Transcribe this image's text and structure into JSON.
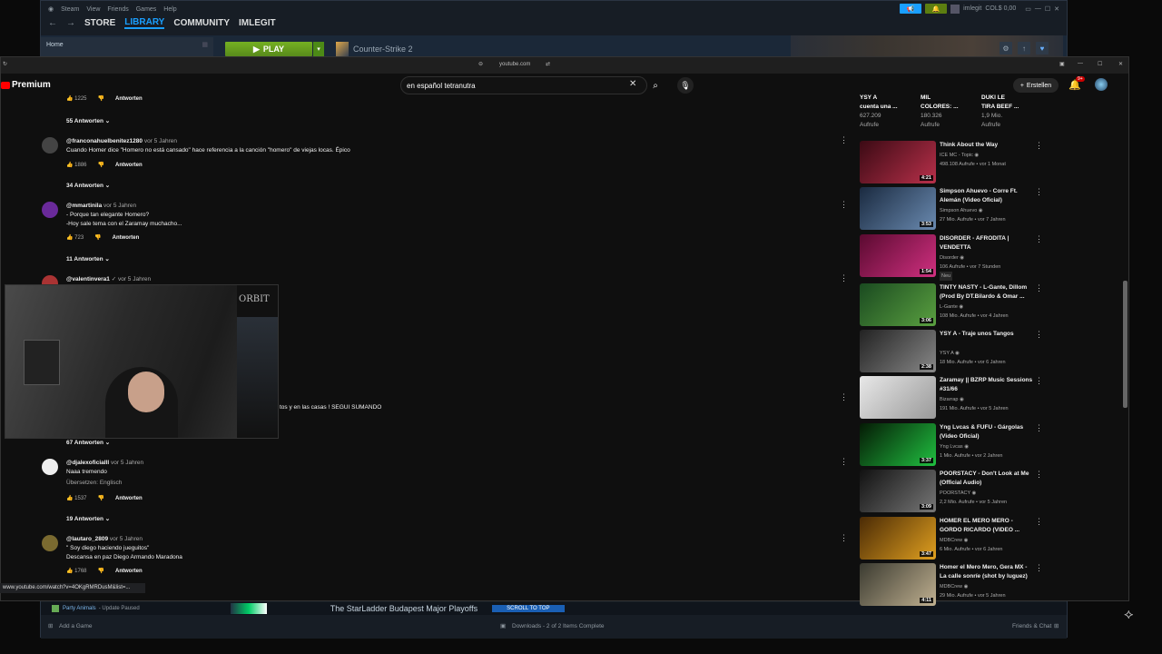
{
  "steam": {
    "menu": [
      "Steam",
      "View",
      "Friends",
      "Games",
      "Help"
    ],
    "nav": [
      "STORE",
      "LIBRARY",
      "COMMUNITY",
      "IMLEGIT"
    ],
    "nav_active": "LIBRARY",
    "user": "imlegit",
    "wallet": "COL$ 0,00",
    "home": "Home",
    "play": "PLAY",
    "game": "Counter-Strike 2",
    "update_item": "Party Animals",
    "update_status": "- Update Paused",
    "news_title": "The StarLadder Budapest Major Playoffs",
    "scroll_top": "SCROLL TO TOP",
    "add_game": "Add a Game",
    "downloads": "Downloads - 2 of 2 Items Complete",
    "friends_chat": "Friends & Chat"
  },
  "browser": {
    "url": "youtube.com",
    "search_value": "en español tetranutra",
    "logo": "Premium",
    "create": "Erstellen",
    "notif_count": "9+",
    "link_hint": "www.youtube.com/watch?v=4OKgRMRDusM&list=..."
  },
  "comments": [
    {
      "type": "acts",
      "likes": "1225",
      "reply": "Antworten"
    },
    {
      "type": "replies",
      "label": "55 Antworten"
    },
    {
      "user": "@franconahuelbenitez1280",
      "when": "vor 5 Jahren",
      "text": "Cuando Homer dice \"Homero no está cansado\" hace referencia a la canción \"homero\" de viejas locas. Épico",
      "likes": "1886",
      "reply": "Antworten",
      "replies": "34 Antworten"
    },
    {
      "user": "@mmartinila",
      "when": "vor 5 Jahren",
      "text": "- Porque tan elegante Homero?",
      "text2": "-Hoy sale tema con el Zaramay muchacho...",
      "likes": "723",
      "reply": "Antworten",
      "replies": "11 Antworten"
    },
    {
      "user": "@valentinvera1",
      "when": "✓ vor 5 Jahren"
    },
    {
      "type": "partial",
      "text": "tos y en las casas ! SEGUI SUMANDO",
      "replies": "67 Antworten"
    },
    {
      "user": "@djalexoficialll",
      "when": "vor 5 Jahren",
      "text": "Naaa tremendo",
      "text2": "Übersetzen: Englisch",
      "likes": "1537",
      "reply": "Antworten",
      "replies": "19 Antworten"
    },
    {
      "user": "@lautaro_2809",
      "when": "vor 5 Jahren",
      "text": "\" Soy diego haciendo jueguitos\"",
      "text2": "Descansa en paz Diego Armando Maradona",
      "likes": "1768",
      "reply": "Antworten"
    }
  ],
  "shorts_top": [
    {
      "title": "YSY A",
      "title2": "cuenta una ...",
      "views": "627.209",
      "unit": "Aufrufe"
    },
    {
      "title": "MIL",
      "title2": "COLORES: ...",
      "views": "180.326",
      "unit": "Aufrufe"
    },
    {
      "title": "DUKI LE",
      "title2": "TIRA BEEF ...",
      "views": "1,9 Mio.",
      "unit": "Aufrufe"
    }
  ],
  "sidebar": [
    {
      "title": "Think About the Way",
      "channel": "ICE MC - Topic",
      "meta": "498.108 Aufrufe • vor 1 Monat",
      "dur": "4:21",
      "c1": "#3b0a14",
      "c2": "#b8304a"
    },
    {
      "title": "Simpson Ahuevo - Corre Ft. Alemán (Video Oficial)",
      "channel": "Simpson Ahuevo",
      "meta": "27 Mio. Aufrufe • vor 7 Jahren",
      "dur": "3:53",
      "c1": "#1a2a40",
      "c2": "#6a8ab0"
    },
    {
      "title": "DISORDER - AFRODITA | VENDETTA",
      "channel": "Disorder",
      "meta": "106 Aufrufe • vor 7 Stunden",
      "extra": "Neu",
      "dur": "1:54",
      "c1": "#5a0a30",
      "c2": "#d03080"
    },
    {
      "title": "TINTY NASTY - L-Gante, Dillom (Prod By DT.Bilardo & Omar ...",
      "channel": "L-Gante",
      "meta": "108 Mio. Aufrufe • vor 4 Jahren",
      "dur": "3:06",
      "c1": "#1a4a20",
      "c2": "#5aa040"
    },
    {
      "title": "YSY A - Traje unos Tangos",
      "channel": "YSY A",
      "meta": "18 Mio. Aufrufe • vor 6 Jahren",
      "dur": "2:38",
      "c1": "#222",
      "c2": "#888"
    },
    {
      "title": "Zaramay || BZRP Music Sessions #31/66",
      "channel": "Bizarrap",
      "meta": "191 Mio. Aufrufe • vor 5 Jahren",
      "dur": "",
      "c1": "#e8e8e8",
      "c2": "#999"
    },
    {
      "title": "Yng Lvcas & FUFU - Gárgolas (Video Oficial)",
      "channel": "Yng Lvcas",
      "meta": "1 Mio. Aufrufe • vor 2 Jahren",
      "dur": "3:37",
      "c1": "#051a05",
      "c2": "#20c040"
    },
    {
      "title": "POORSTACY - Don't Look at Me (Official Audio)",
      "channel": "POORSTACY",
      "meta": "2,2 Mio. Aufrufe • vor 5 Jahren",
      "dur": "3:09",
      "c1": "#111",
      "c2": "#777"
    },
    {
      "title": "HOMER EL MERO MERO - GORDO RICARDO (VIDEO ...",
      "channel": "MDBCrew",
      "meta": "6 Mio. Aufrufe • vor 6 Jahren",
      "dur": "3:47",
      "c1": "#4a2a05",
      "c2": "#e0a020"
    },
    {
      "title": "Homer el Mero Mero, Gera MX - La calle sonríe (shot by luguez)",
      "channel": "MDBCrew",
      "meta": "29 Mio. Aufrufe • vor 5 Jahren",
      "dur": "4:11",
      "c1": "#3a3a30",
      "c2": "#c0b090"
    }
  ]
}
